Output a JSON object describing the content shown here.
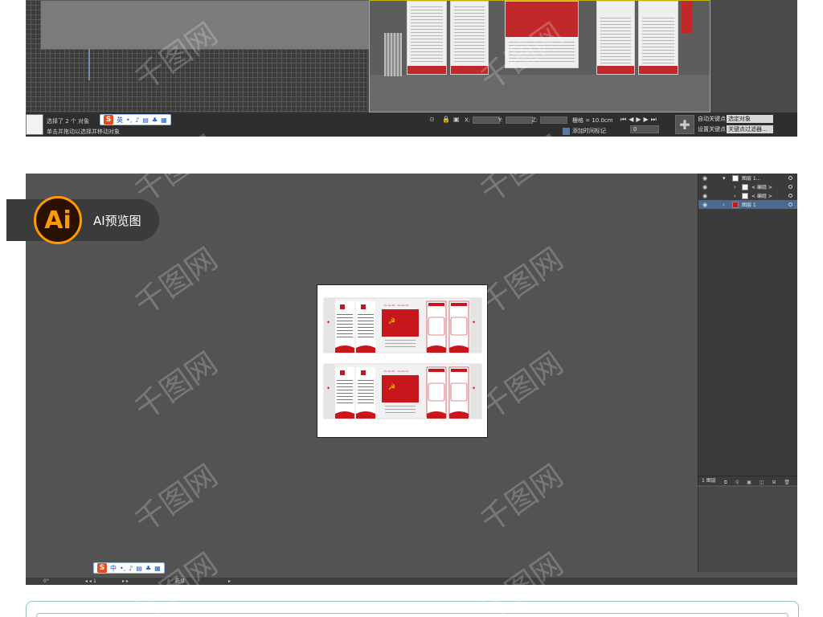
{
  "max_status": {
    "selection_text": "选择了 2 个 对象",
    "hint_text": "单击并拖动以选择并移动对象",
    "coord_x": "X:",
    "coord_y": "Y:",
    "coord_z": "Z:",
    "grid": "栅格 = 10.0cm",
    "add_time_tag": "添加时间标记",
    "frame_value": "0",
    "auto_key": "自动关键点",
    "set_key": "设置关键点",
    "selection_set": "选定对象",
    "key_filters": "关键点过滤器..."
  },
  "ime_top": {
    "logo": "S",
    "mode": "英"
  },
  "ime_bottom": {
    "logo": "S",
    "mode": "中"
  },
  "ai_badge": {
    "logo": "Ai",
    "label": "AI预览图"
  },
  "layers": [
    {
      "name": "图层 1...",
      "active": false
    },
    {
      "name": "< 编组 >",
      "active": false
    },
    {
      "name": "< 编组 >",
      "active": false
    },
    {
      "name": "图层 1",
      "active": true
    }
  ],
  "layers_footer": "1 图层",
  "ai_bottom": {
    "rotation": "0°",
    "artboard_no": "1",
    "tool": "选择"
  },
  "colors": {
    "party_red": "#c8161d",
    "ai_orange": "#ff9a00",
    "canvas_gray": "#535353"
  },
  "watermark_text": "千图网"
}
